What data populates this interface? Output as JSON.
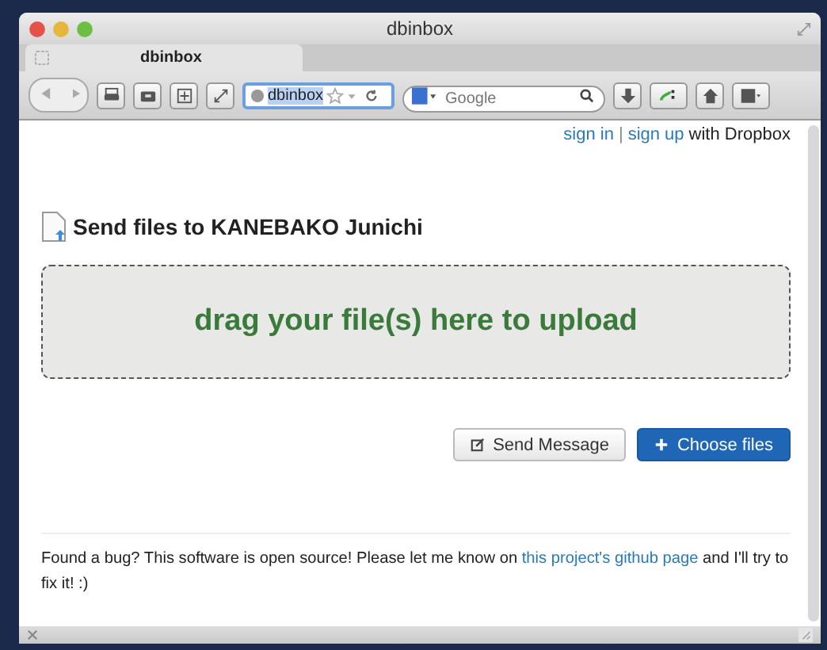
{
  "window": {
    "title": "dbinbox"
  },
  "tabs": [
    {
      "label": "dbinbox",
      "selected": true
    }
  ],
  "address_bar": {
    "value": "dbinbox"
  },
  "search": {
    "placeholder": "Google"
  },
  "auth": {
    "sign_in": "sign in",
    "separator": "|",
    "sign_up": "sign up",
    "suffix": "with Dropbox"
  },
  "heading": "Send files to KANEBAKO Junichi",
  "dropzone": {
    "text": "drag your file(s) here to upload"
  },
  "buttons": [
    {
      "kind": "message",
      "label": "Send Message"
    },
    {
      "kind": "choose",
      "label": "Choose files"
    }
  ],
  "footer": {
    "before": "Found a bug? This software is open source! Please let me know on",
    "link": "this project's github page",
    "after": "and I'll try to fix it! :)"
  }
}
